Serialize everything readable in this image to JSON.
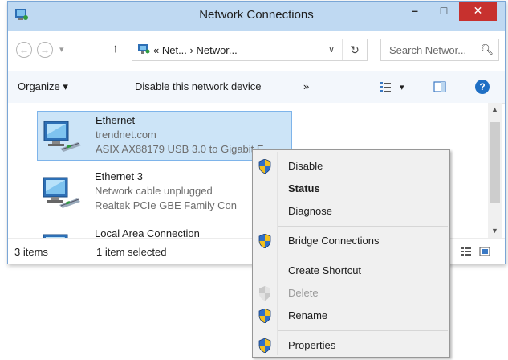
{
  "window": {
    "title": "Network Connections",
    "controls": {
      "minimize": "–",
      "maximize": "□",
      "close": "✕"
    }
  },
  "address": {
    "back": "←",
    "forward": "→",
    "recent": "▾",
    "up": "↑",
    "path": "« Net...  ›  Networ...",
    "dropdown": "∨",
    "refresh": "↻",
    "search_placeholder": "Search Networ..."
  },
  "toolbar": {
    "organize_label": "Organize ▾",
    "disable_label": "Disable this network device",
    "more_label": "»",
    "view_dropdown": "▾",
    "help_label": "?"
  },
  "items": [
    {
      "name": "Ethernet",
      "status": "trendnet.com",
      "device": "ASIX AX88179 USB 3.0 to Gigabit E"
    },
    {
      "name": "Ethernet 3",
      "status": "Network cable unplugged",
      "device": "Realtek PCIe GBE Family Con"
    },
    {
      "name": "Local Area Connection",
      "status": "",
      "device": ""
    }
  ],
  "statusbar": {
    "count": "3 items",
    "selected": "1 item selected"
  },
  "context_menu": {
    "disable": "Disable",
    "status": "Status",
    "diagnose": "Diagnose",
    "bridge": "Bridge Connections",
    "shortcut": "Create Shortcut",
    "delete": "Delete",
    "rename": "Rename",
    "properties": "Properties"
  },
  "colors": {
    "title_bar": "#bfd9f2",
    "close_button": "#c7312e",
    "selection": "#cce4f7",
    "menu_background": "#f0f0f0"
  }
}
